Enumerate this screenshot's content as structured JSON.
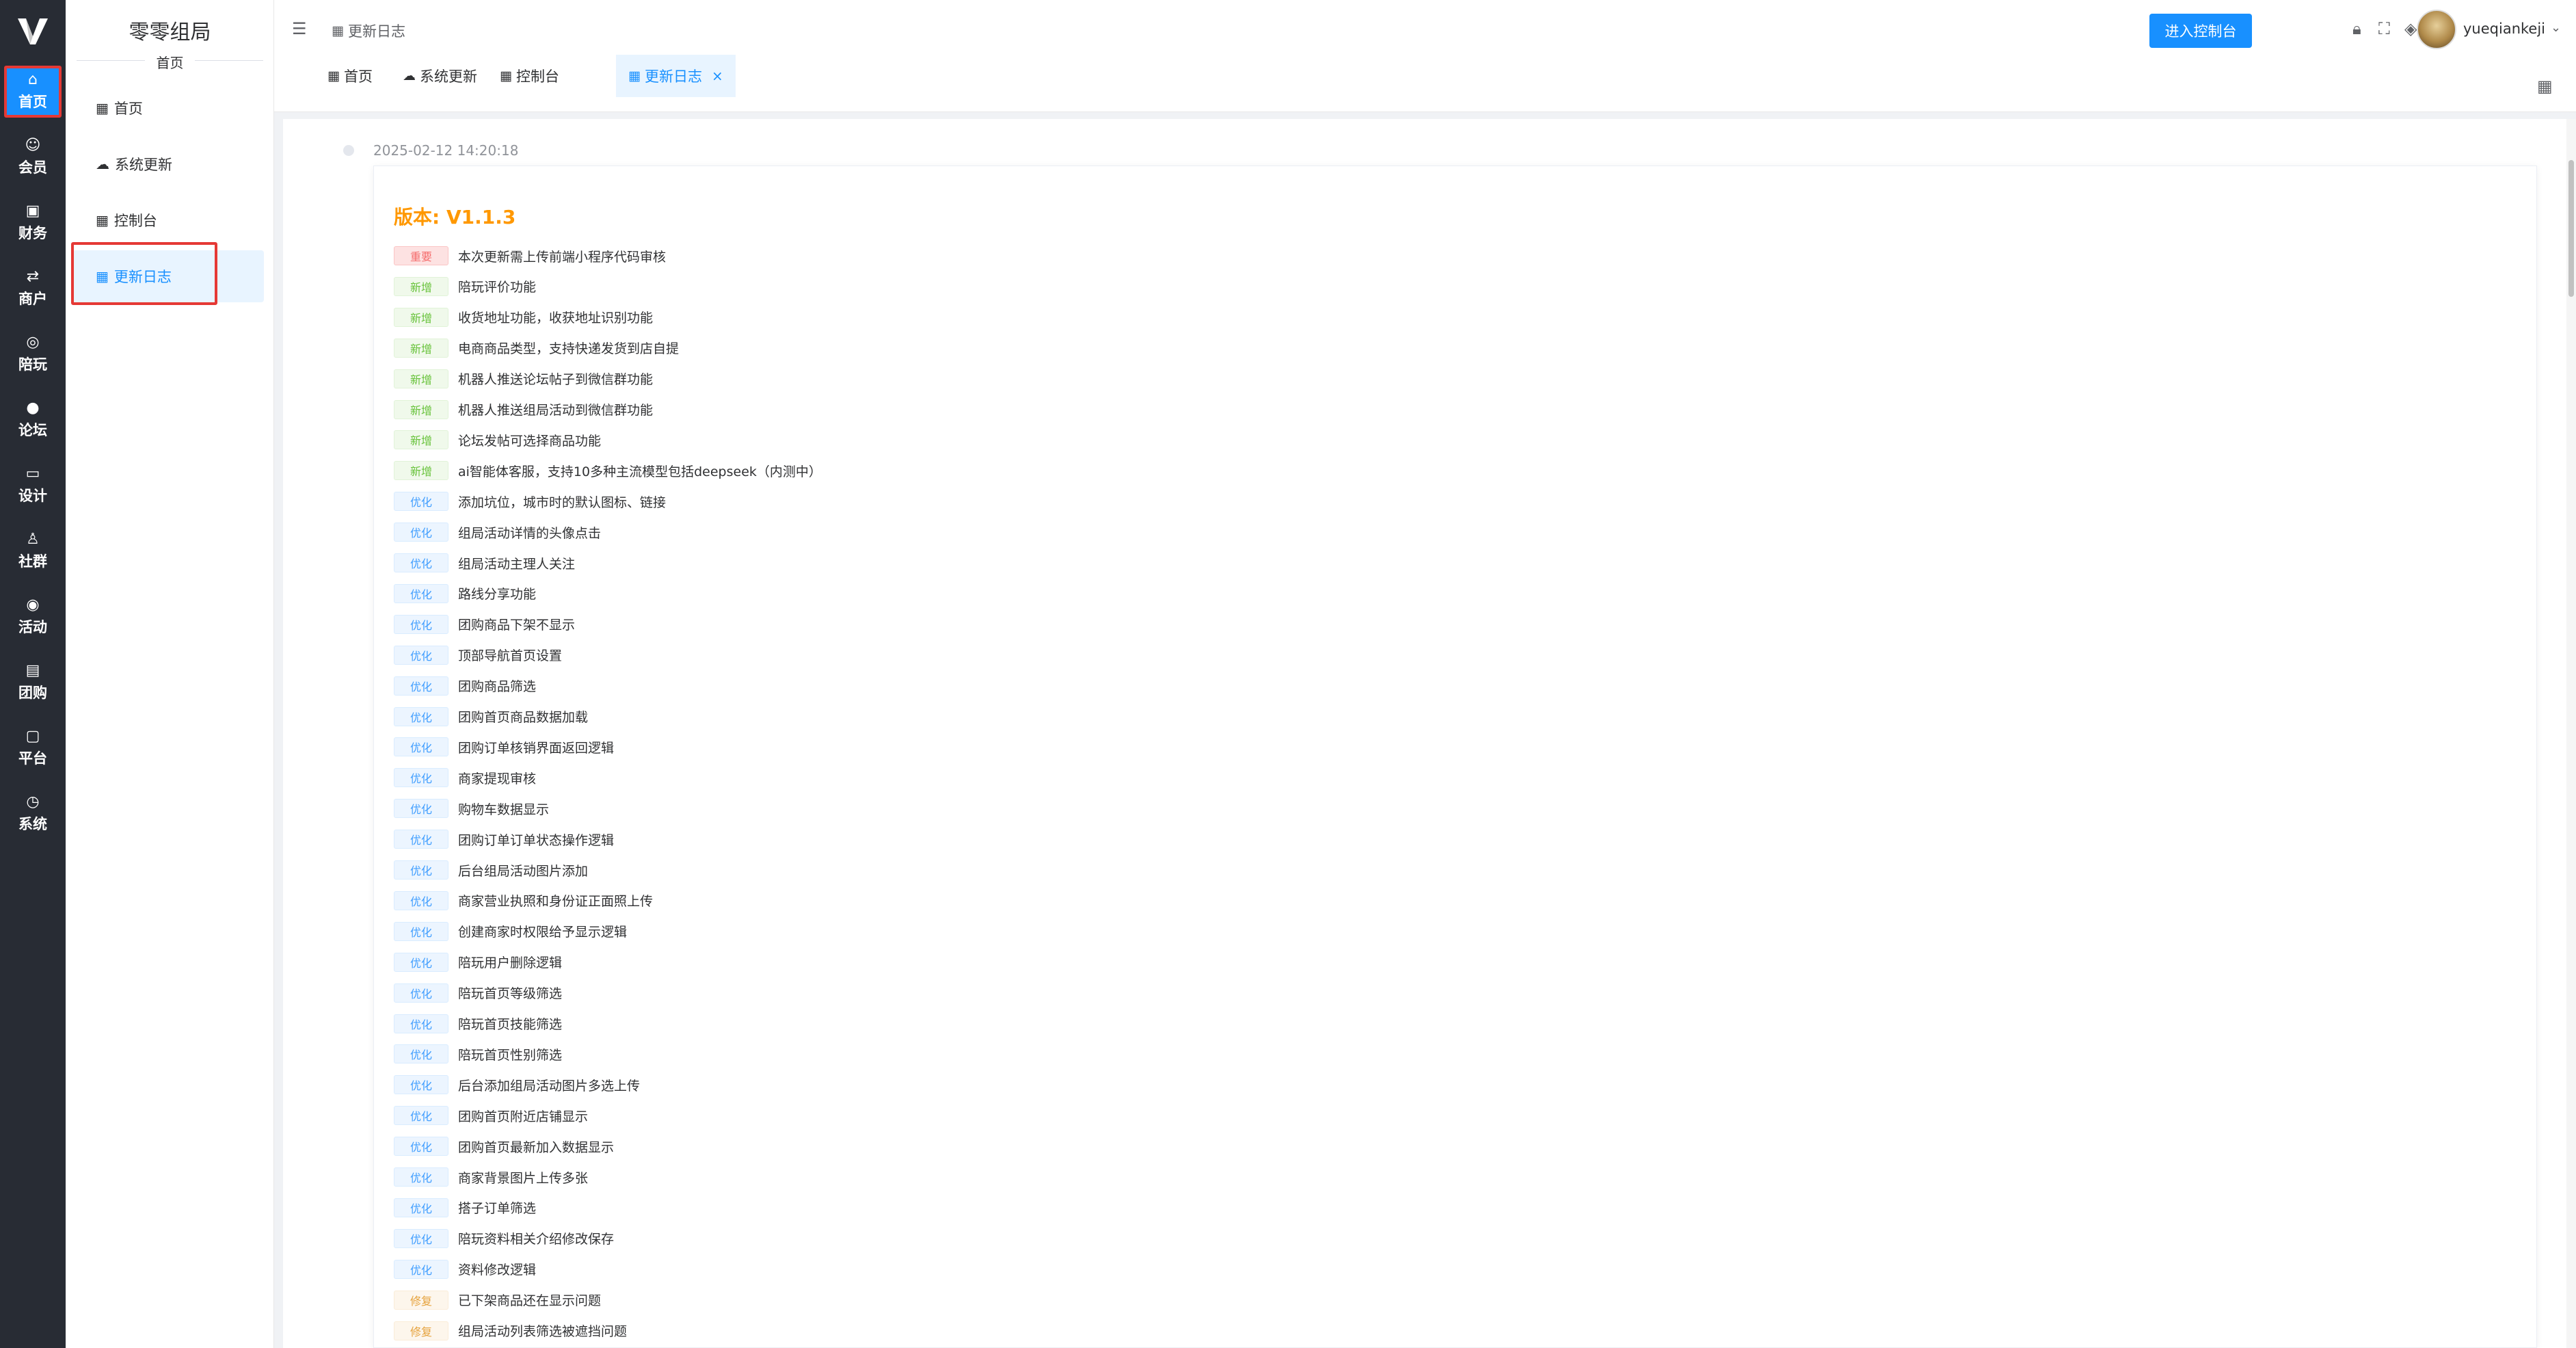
{
  "app": {
    "logo_glyph": "V",
    "brand": "零零组局",
    "brand_sub": "首页"
  },
  "rail": [
    {
      "label": "首页",
      "icon": "⌂",
      "icon_name": "home-icon",
      "active": true
    },
    {
      "label": "会员",
      "icon": "☺",
      "icon_name": "member-icon"
    },
    {
      "label": "财务",
      "icon": "▣",
      "icon_name": "finance-icon"
    },
    {
      "label": "商户",
      "icon": "⇄",
      "icon_name": "merchant-icon"
    },
    {
      "label": "陪玩",
      "icon": "◎",
      "icon_name": "companion-icon"
    },
    {
      "label": "论坛",
      "icon": "●",
      "icon_name": "forum-icon"
    },
    {
      "label": "设计",
      "icon": "▭",
      "icon_name": "design-icon"
    },
    {
      "label": "社群",
      "icon": "♙",
      "icon_name": "community-icon"
    },
    {
      "label": "活动",
      "icon": "◉",
      "icon_name": "activity-icon"
    },
    {
      "label": "团购",
      "icon": "▤",
      "icon_name": "groupbuy-icon"
    },
    {
      "label": "平台",
      "icon": "▢",
      "icon_name": "platform-icon"
    },
    {
      "label": "系统",
      "icon": "◷",
      "icon_name": "system-icon"
    }
  ],
  "subnav": [
    {
      "label": "首页",
      "icon": "▦"
    },
    {
      "label": "系统更新",
      "icon": "☁"
    },
    {
      "label": "控制台",
      "icon": "▦"
    },
    {
      "label": "更新日志",
      "icon": "▦",
      "active": true
    }
  ],
  "header": {
    "breadcrumb": "更新日志",
    "enter_console": "进入控制台",
    "username": "yueqiankeji"
  },
  "tabs": [
    {
      "label": "首页"
    },
    {
      "label": "系统更新"
    },
    {
      "label": "控制台"
    },
    {
      "label": "更新日志",
      "active": true,
      "close": "×"
    }
  ],
  "changelog": {
    "timestamp": "2025-02-12 14:20:18",
    "version": "版本: V1.1.3",
    "entries": [
      {
        "tag": "重要",
        "type": "imp",
        "text": "本次更新需上传前端小程序代码审核"
      },
      {
        "tag": "新增",
        "type": "new",
        "text": "陪玩评价功能"
      },
      {
        "tag": "新增",
        "type": "new",
        "text": "收货地址功能，收获地址识别功能"
      },
      {
        "tag": "新增",
        "type": "new",
        "text": "电商商品类型，支持快递发货到店自提"
      },
      {
        "tag": "新增",
        "type": "new",
        "text": "机器人推送论坛帖子到微信群功能"
      },
      {
        "tag": "新增",
        "type": "new",
        "text": "机器人推送组局活动到微信群功能"
      },
      {
        "tag": "新增",
        "type": "new",
        "text": "论坛发帖可选择商品功能"
      },
      {
        "tag": "新增",
        "type": "new",
        "text": "ai智能体客服，支持10多种主流模型包括deepseek（内测中）"
      },
      {
        "tag": "优化",
        "type": "opt",
        "text": "添加坑位，城市时的默认图标、链接"
      },
      {
        "tag": "优化",
        "type": "opt",
        "text": "组局活动详情的头像点击"
      },
      {
        "tag": "优化",
        "type": "opt",
        "text": "组局活动主理人关注"
      },
      {
        "tag": "优化",
        "type": "opt",
        "text": "路线分享功能"
      },
      {
        "tag": "优化",
        "type": "opt",
        "text": "团购商品下架不显示"
      },
      {
        "tag": "优化",
        "type": "opt",
        "text": "顶部导航首页设置"
      },
      {
        "tag": "优化",
        "type": "opt",
        "text": "团购商品筛选"
      },
      {
        "tag": "优化",
        "type": "opt",
        "text": "团购首页商品数据加载"
      },
      {
        "tag": "优化",
        "type": "opt",
        "text": "团购订单核销界面返回逻辑"
      },
      {
        "tag": "优化",
        "type": "opt",
        "text": "商家提现审核"
      },
      {
        "tag": "优化",
        "type": "opt",
        "text": "购物车数据显示"
      },
      {
        "tag": "优化",
        "type": "opt",
        "text": "团购订单订单状态操作逻辑"
      },
      {
        "tag": "优化",
        "type": "opt",
        "text": "后台组局活动图片添加"
      },
      {
        "tag": "优化",
        "type": "opt",
        "text": "商家营业执照和身份证正面照上传"
      },
      {
        "tag": "优化",
        "type": "opt",
        "text": "创建商家时权限给予显示逻辑"
      },
      {
        "tag": "优化",
        "type": "opt",
        "text": "陪玩用户删除逻辑"
      },
      {
        "tag": "优化",
        "type": "opt",
        "text": "陪玩首页等级筛选"
      },
      {
        "tag": "优化",
        "type": "opt",
        "text": "陪玩首页技能筛选"
      },
      {
        "tag": "优化",
        "type": "opt",
        "text": "陪玩首页性别筛选"
      },
      {
        "tag": "优化",
        "type": "opt",
        "text": "后台添加组局活动图片多选上传"
      },
      {
        "tag": "优化",
        "type": "opt",
        "text": "团购首页附近店铺显示"
      },
      {
        "tag": "优化",
        "type": "opt",
        "text": "团购首页最新加入数据显示"
      },
      {
        "tag": "优化",
        "type": "opt",
        "text": "商家背景图片上传多张"
      },
      {
        "tag": "优化",
        "type": "opt",
        "text": "搭子订单筛选"
      },
      {
        "tag": "优化",
        "type": "opt",
        "text": "陪玩资料相关介绍修改保存"
      },
      {
        "tag": "优化",
        "type": "opt",
        "text": "资料修改逻辑"
      },
      {
        "tag": "修复",
        "type": "fix",
        "text": "已下架商品还在显示问题"
      },
      {
        "tag": "修复",
        "type": "fix",
        "text": "组局活动列表筛选被遮挡问题"
      }
    ]
  },
  "colors": {
    "rail_bg": "#282c34",
    "accent": "#1890ff",
    "highlight_box": "#e53935",
    "version": "#ff9800"
  }
}
